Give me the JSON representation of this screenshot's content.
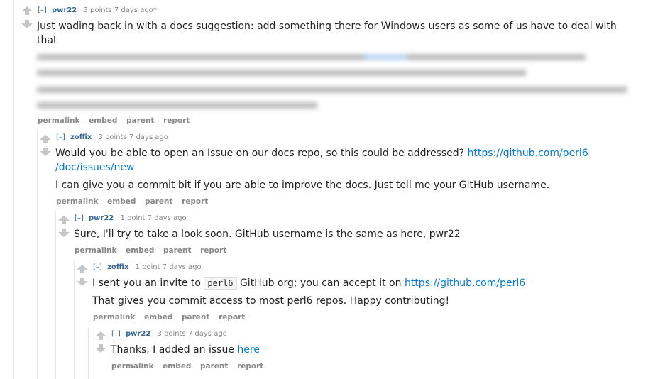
{
  "colors": {
    "link": "#0079d3",
    "author": "#336699",
    "meta": "#888888",
    "thread_line": "#e6e6e6"
  },
  "icons": {
    "upvote": "arrow-up-icon",
    "downvote": "arrow-down-icon"
  },
  "actions": [
    "permalink",
    "embed",
    "parent",
    "report"
  ],
  "comments": [
    {
      "toggle": "[–]",
      "author": "pwr22",
      "meta": "3 points 7 days ago*",
      "p1": "Just wading back in with a docs suggestion: add something there for Windows users as some of us have to deal with that"
    },
    {
      "toggle": "[–]",
      "author": "zoffix",
      "meta": "3 points 7 days ago",
      "p1_text": "Would you be able to open an Issue on our docs repo, so this could be addressed? ",
      "p1_link_a": "https://github.com/perl6",
      "p1_link_b": "/doc/issues/new",
      "p2": "I can give you a commit bit if you are able to improve the docs. Just tell me your GitHub username."
    },
    {
      "toggle": "[–]",
      "author": "pwr22",
      "meta": "1 point 7 days ago",
      "p1": "Sure, I'll try to take a look soon. GitHub username is the same as here, pwr22"
    },
    {
      "toggle": "[–]",
      "author": "zoffix",
      "meta": "1 point 7 days ago",
      "p1_a": "I sent you an invite to ",
      "p1_code": "perl6",
      "p1_b": " GitHub org; you can accept it on ",
      "p1_link": "https://github.com/perl6",
      "p2": "That gives you commit access to most perl6 repos. Happy contributing!"
    },
    {
      "toggle": "[–]",
      "author": "pwr22",
      "meta": "3 points 7 days ago",
      "p1_text": "Thanks, I added an issue ",
      "p1_link": "here"
    }
  ]
}
